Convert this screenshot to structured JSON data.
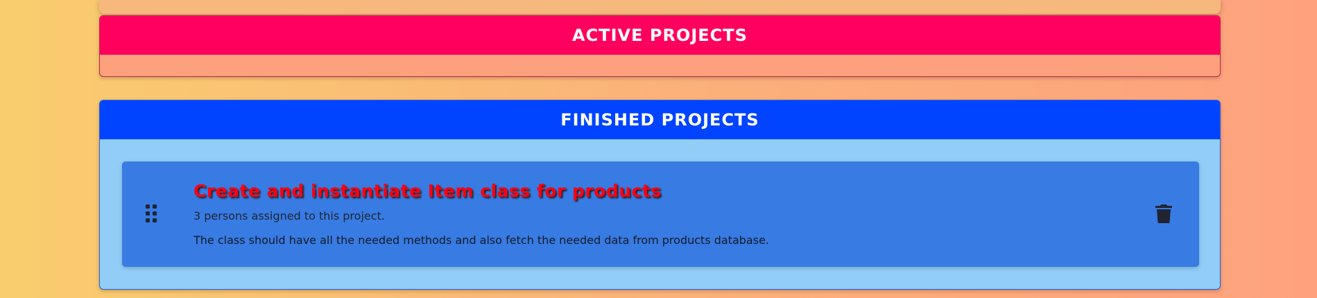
{
  "sections": {
    "active": {
      "title": "ACTIVE PROJECTS",
      "header_color": "#ff005e",
      "body_color": "#fca07e"
    },
    "finished": {
      "title": "FINISHED PROJECTS",
      "header_color": "#0044ff",
      "body_color": "#92cdf7",
      "projects": [
        {
          "title": "Create and instantiate Item class for products",
          "assigned": "3 persons assigned to this project.",
          "description": "The class should have all the needed methods and also fetch the needed data from products database.",
          "card_color": "#387be3",
          "title_color": "#ff0014",
          "icons": {
            "drag": "drag-handle-icon",
            "delete": "trash-icon"
          }
        }
      ]
    }
  }
}
